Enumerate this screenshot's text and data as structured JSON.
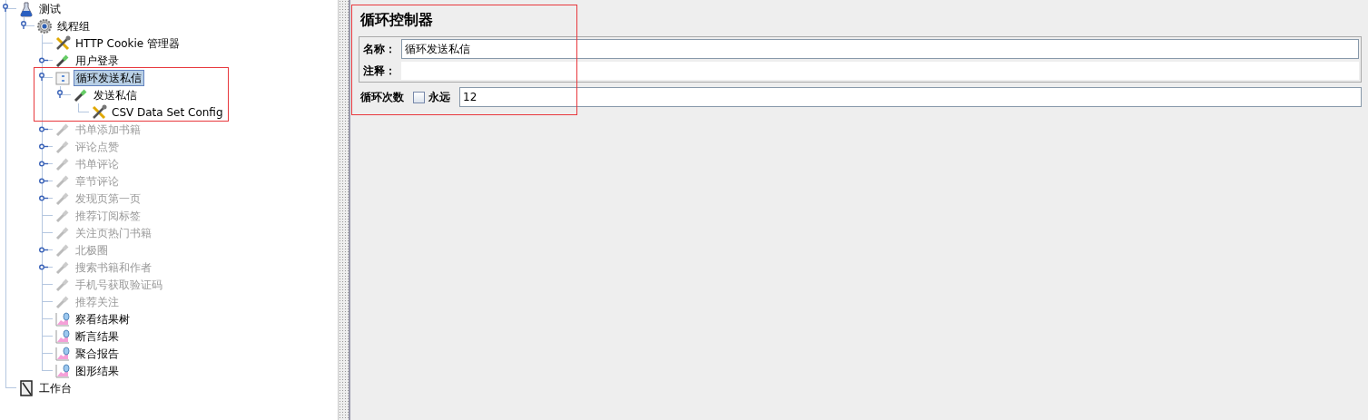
{
  "tree": [
    {
      "label": "测试",
      "kind": "testplan",
      "expanded": true,
      "selected": false,
      "disabled": false,
      "children": [
        {
          "label": "线程组",
          "kind": "threadgroup",
          "expanded": true,
          "selected": false,
          "disabled": false,
          "children": [
            {
              "label": "HTTP Cookie 管理器",
              "kind": "config",
              "selected": false,
              "disabled": false
            },
            {
              "label": "用户登录",
              "kind": "sampler",
              "expanded": false,
              "selected": false,
              "disabled": false
            },
            {
              "label": "循环发送私信",
              "kind": "controller",
              "expanded": true,
              "selected": true,
              "disabled": false,
              "outlined": true,
              "children": [
                {
                  "label": "发送私信",
                  "kind": "sampler",
                  "expanded": true,
                  "selected": false,
                  "disabled": false,
                  "children": [
                    {
                      "label": "CSV Data Set Config",
                      "kind": "config",
                      "selected": false,
                      "disabled": false
                    }
                  ]
                }
              ]
            },
            {
              "label": "书单添加书籍",
              "kind": "sampler",
              "expanded": false,
              "selected": false,
              "disabled": true
            },
            {
              "label": "评论点赞",
              "kind": "sampler",
              "expanded": false,
              "selected": false,
              "disabled": true
            },
            {
              "label": "书单评论",
              "kind": "sampler",
              "expanded": false,
              "selected": false,
              "disabled": true
            },
            {
              "label": "章节评论",
              "kind": "sampler",
              "expanded": false,
              "selected": false,
              "disabled": true
            },
            {
              "label": "发现页第一页",
              "kind": "sampler",
              "expanded": false,
              "selected": false,
              "disabled": true
            },
            {
              "label": "推荐订阅标签",
              "kind": "sampler",
              "selected": false,
              "disabled": true
            },
            {
              "label": "关注页热门书籍",
              "kind": "sampler",
              "selected": false,
              "disabled": true
            },
            {
              "label": "北极圈",
              "kind": "sampler",
              "expanded": false,
              "selected": false,
              "disabled": true
            },
            {
              "label": "搜索书籍和作者",
              "kind": "sampler",
              "expanded": false,
              "selected": false,
              "disabled": true
            },
            {
              "label": "手机号获取验证码",
              "kind": "sampler",
              "selected": false,
              "disabled": true
            },
            {
              "label": "推荐关注",
              "kind": "sampler",
              "selected": false,
              "disabled": true
            },
            {
              "label": "察看结果树",
              "kind": "listener",
              "selected": false,
              "disabled": false
            },
            {
              "label": "断言结果",
              "kind": "listener",
              "selected": false,
              "disabled": false
            },
            {
              "label": "聚合报告",
              "kind": "listener",
              "selected": false,
              "disabled": false
            },
            {
              "label": "图形结果",
              "kind": "listener",
              "selected": false,
              "disabled": false
            }
          ]
        }
      ]
    },
    {
      "label": "工作台",
      "kind": "workbench",
      "selected": false,
      "disabled": false
    }
  ],
  "editor": {
    "title": "循环控制器",
    "outlined": true,
    "name_label": "名称：",
    "name_value": "循环发送私信",
    "comment_label": "注释：",
    "loop_label": "循环次数",
    "forever_checked": false,
    "forever_label": "永远",
    "loop_value": "12"
  }
}
